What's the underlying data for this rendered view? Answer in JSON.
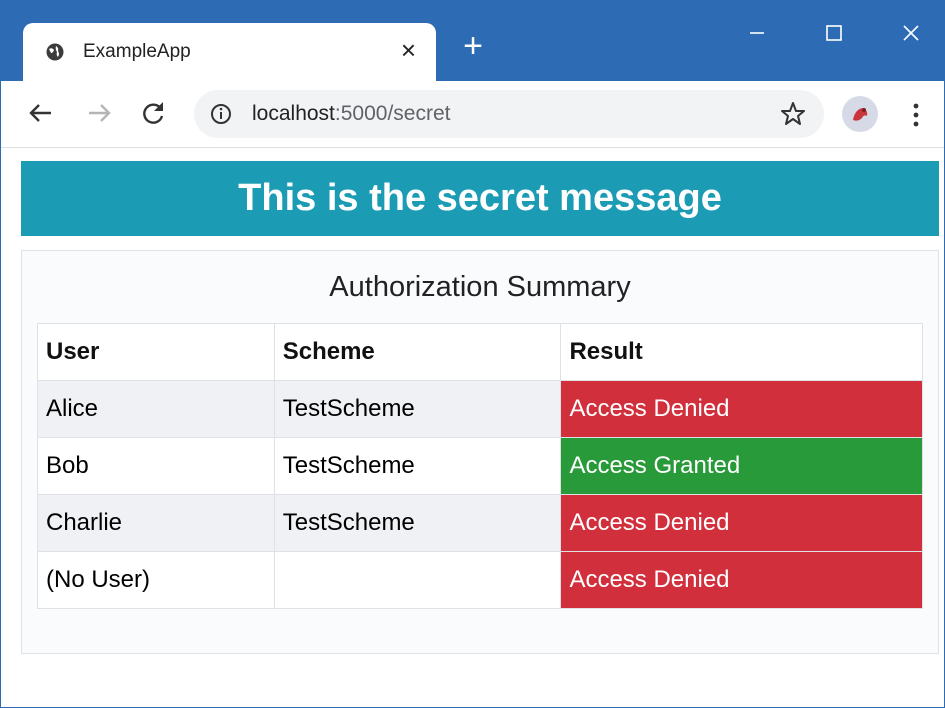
{
  "browser": {
    "tab_title": "ExampleApp",
    "tab_close": "×",
    "new_tab": "+",
    "url_host": "localhost",
    "url_rest": ":5000/secret"
  },
  "page": {
    "banner": "This is the secret message",
    "card_title": "Authorization Summary",
    "table": {
      "headers": [
        "User",
        "Scheme",
        "Result"
      ],
      "rows": [
        {
          "user": "Alice",
          "scheme": "TestScheme",
          "result": "Access Denied"
        },
        {
          "user": "Bob",
          "scheme": "TestScheme",
          "result": "Access Granted"
        },
        {
          "user": "Charlie",
          "scheme": "TestScheme",
          "result": "Access Denied"
        },
        {
          "user": "(No User)",
          "scheme": "",
          "result": "Access Denied"
        }
      ]
    }
  },
  "colors": {
    "titlebar": "#2d6bb5",
    "banner": "#1c9cb4",
    "denied": "#d22f3d",
    "granted": "#289a3a"
  },
  "icons": [
    "globe-icon",
    "close-icon",
    "plus-icon",
    "minimize-icon",
    "maximize-icon",
    "window-close-icon",
    "back-arrow-icon",
    "forward-arrow-icon",
    "reload-icon",
    "info-icon",
    "star-icon",
    "profile-avatar-icon",
    "menu-dots-icon"
  ]
}
